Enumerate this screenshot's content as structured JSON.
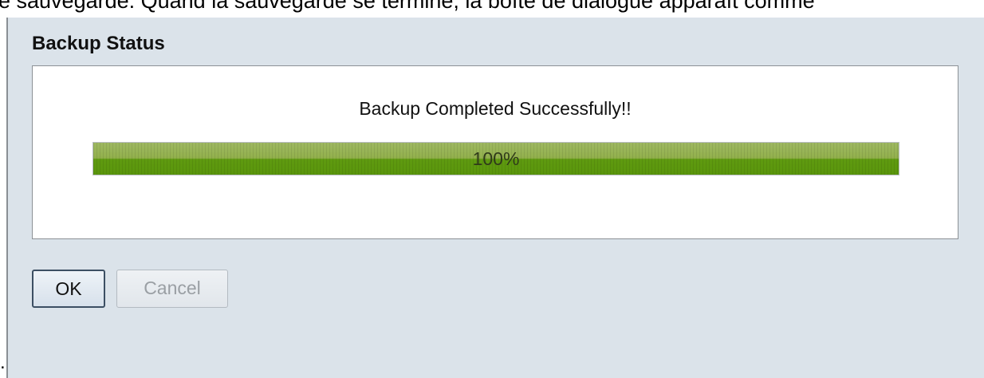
{
  "background_text": "e sauvegarde. Quand la sauvegarde se termine, la boîte de dialogue apparaît comme",
  "stray_mark": ".",
  "dialog": {
    "title": "Backup Status",
    "status_message": "Backup Completed Successfully!!",
    "progress": {
      "percent": 100,
      "label": "100%",
      "fill_color": "#6b9f1e"
    },
    "buttons": {
      "ok_label": "OK",
      "cancel_label": "Cancel"
    }
  }
}
